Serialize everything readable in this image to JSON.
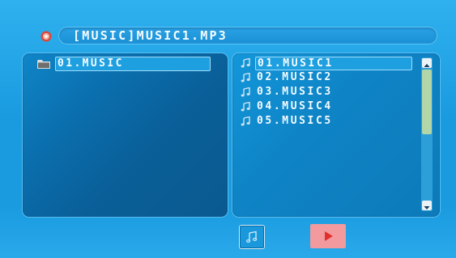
{
  "header": {
    "path": "[MUSIC]MUSIC1.MP3",
    "disc_icon": "disc-icon"
  },
  "folders": [
    {
      "label": "01.MUSIC",
      "icon": "folder-icon"
    }
  ],
  "files": [
    {
      "label": "01.MUSIC1",
      "icon": "music-note-icon",
      "selected": true
    },
    {
      "label": "02.MUSIC2",
      "icon": "music-note-icon",
      "selected": false
    },
    {
      "label": "03.MUSIC3",
      "icon": "music-note-icon",
      "selected": false
    },
    {
      "label": "04.MUSIC4",
      "icon": "music-note-icon",
      "selected": false
    },
    {
      "label": "05.MUSIC5",
      "icon": "music-note-icon",
      "selected": false
    }
  ],
  "scrollbar": {
    "position": 0,
    "visible_fraction": 0.43
  },
  "buttons": {
    "music_icon": "music-note-icon",
    "play_icon": "play-icon"
  },
  "colors": {
    "background": "#1e9fe0",
    "panel": "#0b6fae",
    "text": "#f4fbff",
    "play_button": "#f29a9e",
    "play_arrow": "#e0302f",
    "scroll_thumb": "#b3d6a8"
  }
}
